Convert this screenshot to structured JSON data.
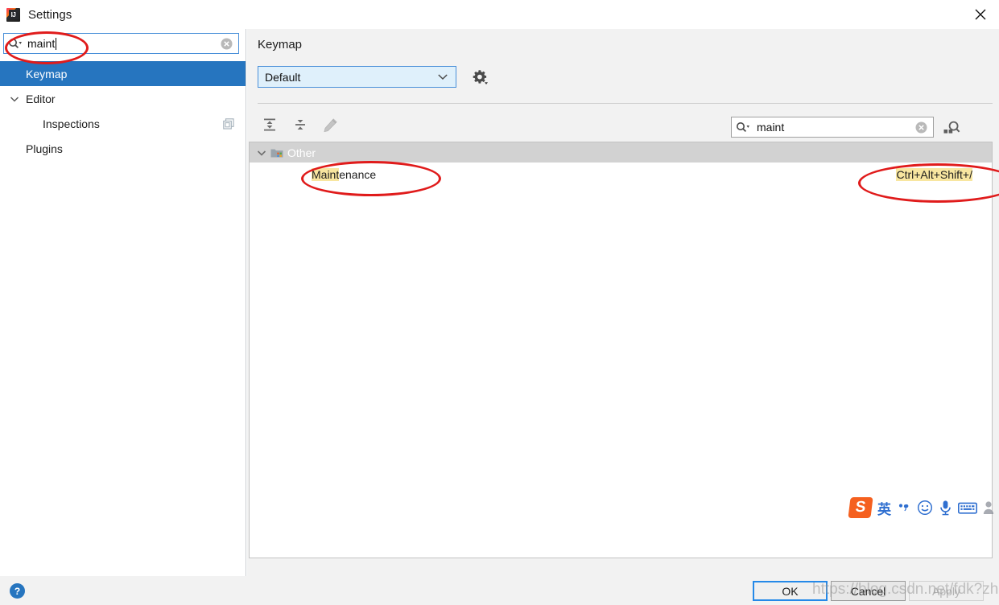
{
  "window": {
    "title": "Settings",
    "app_icon": "intellij-idea-icon",
    "close_icon": "close-icon"
  },
  "sidebar": {
    "search": {
      "icon": "search-icon",
      "value": "maint",
      "placeholder": "",
      "clear_icon": "clear-icon"
    },
    "items": [
      {
        "label": "Keymap",
        "selected": true,
        "indent": 0,
        "arrow": "",
        "trailing_icon": ""
      },
      {
        "label": "Editor",
        "selected": false,
        "indent": 0,
        "arrow": "chevron-down-icon",
        "trailing_icon": ""
      },
      {
        "label": "Inspections",
        "selected": false,
        "indent": 1,
        "arrow": "",
        "trailing_icon": "copy-icon"
      },
      {
        "label": "Plugins",
        "selected": false,
        "indent": 0,
        "arrow": "",
        "trailing_icon": ""
      }
    ]
  },
  "content": {
    "title": "Keymap",
    "keymap_select": {
      "value": "Default",
      "chevron_icon": "chevron-down-icon",
      "options": [
        "Default"
      ]
    },
    "gear_icon": "gear-dropdown-icon",
    "toolbar": [
      {
        "name": "expand-all-icon",
        "label": "Expand All"
      },
      {
        "name": "collapse-all-icon",
        "label": "Collapse All"
      },
      {
        "name": "edit-shortcut-icon",
        "label": "Edit Shortcut"
      }
    ],
    "find": {
      "icon": "search-icon",
      "value": "maint",
      "clear_icon": "clear-icon",
      "by_shortcut_icon": "find-by-shortcut-icon"
    },
    "tree": {
      "group": {
        "label": "Other",
        "toggle_icon": "chevron-down-icon",
        "folder_icon": "folder-icon",
        "expanded": true
      },
      "rows": [
        {
          "label_highlight": "Maint",
          "label_rest": "enance",
          "shortcut": "Ctrl+Alt+Shift+/"
        }
      ]
    }
  },
  "bottom": {
    "help_icon": "help-icon",
    "help_label": "?",
    "buttons": [
      {
        "label": "OK",
        "state": "default-focused"
      },
      {
        "label": "Cancel",
        "state": "enabled"
      },
      {
        "label": "Apply",
        "state": "disabled"
      }
    ]
  },
  "ime": {
    "logo_label": "S",
    "items": [
      {
        "name": "ime-language-icon",
        "label": "英"
      },
      {
        "name": "ime-punctuation-icon",
        "label": "，"
      },
      {
        "name": "ime-emoji-icon",
        "label": "☺"
      },
      {
        "name": "ime-voice-icon",
        "label": "🎤"
      },
      {
        "name": "ime-keyboard-icon",
        "label": "⌨"
      },
      {
        "name": "ime-user-icon",
        "label": "👤"
      }
    ]
  },
  "annotations": {
    "watermark_text": "https://blog.csdn.net/fdk?zhang",
    "ellipse_color": "#e01b1b"
  },
  "colors": {
    "accent": "#2675bf",
    "focus_border": "#4a90d9",
    "panel_bg": "#f2f2f2",
    "highlight_yellow": "#f8e6a0",
    "annotation_red": "#e01b1b"
  }
}
